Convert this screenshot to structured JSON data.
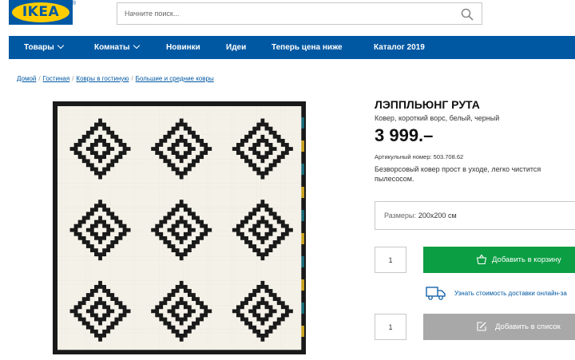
{
  "header": {
    "logo_text": "IKEA",
    "logo_mark": "®",
    "search_placeholder": "Начните поиск..."
  },
  "nav": {
    "items": [
      {
        "label": "Товары",
        "dropdown": true
      },
      {
        "label": "Комнаты",
        "dropdown": true
      },
      {
        "label": "Новинки",
        "dropdown": false
      },
      {
        "label": "Идеи",
        "dropdown": false
      },
      {
        "label": "Теперь цена ниже",
        "dropdown": false
      },
      {
        "label": "Каталог 2019",
        "dropdown": false
      }
    ]
  },
  "breadcrumb": [
    "Домой",
    "Гостиная",
    "Ковры в гостиную",
    "Большие и средние ковры"
  ],
  "product": {
    "name": "ЛЭППЛЬЮНГ РУТА",
    "description": "Ковер, короткий ворс, белый, черный",
    "price": "3 999.–",
    "article": "Артикульный номер: 503.708.62",
    "text": "Безворсовый ковер прост в уходе, легко чистится пылесосом.",
    "size_label": "Размеры:",
    "size_value": "200x200 см",
    "quantity_cart": "1",
    "quantity_list": "1",
    "add_to_cart": "Добавить в корзину",
    "delivery_text": "Узнать стоимость доставки онлайн-за",
    "add_to_list": "Добавить в список"
  },
  "colors": {
    "brand_blue": "#0058a3",
    "brand_yellow": "#ffcc00",
    "cart_green": "#0b9e43",
    "list_gray": "#a8a8a8",
    "rug_black": "#1a1a1a",
    "rug_white": "#f4f1e8",
    "rug_edge_teal": "#1a6a78",
    "rug_edge_mustard": "#c9a020"
  }
}
